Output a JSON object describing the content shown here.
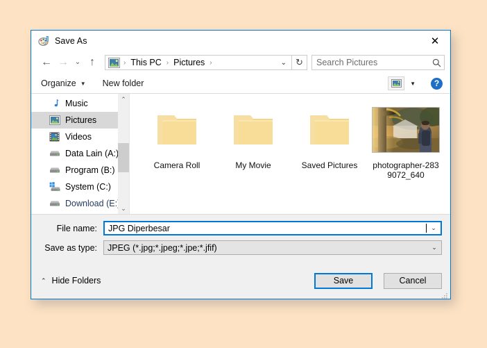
{
  "window": {
    "title": "Save As",
    "title_icon": "paint-palette-icon",
    "close_label": "✕"
  },
  "nav": {
    "back_icon": "←",
    "forward_icon": "→",
    "recent_icon": "⌄",
    "up_icon": "↑",
    "refresh_icon": "↻",
    "breadcrumb": [
      "This PC",
      "Pictures"
    ],
    "breadcrumb_sep": "›",
    "breadcrumb_chevron": "⌄"
  },
  "search": {
    "placeholder": "Search Pictures",
    "icon": "search-icon"
  },
  "toolbar": {
    "organize_label": "Organize",
    "organize_caret": "▼",
    "new_folder_label": "New folder",
    "view_caret": "▼",
    "help_label": "?"
  },
  "sidebar": {
    "items": [
      {
        "label": "Music",
        "icon": "music-note-icon",
        "selected": false
      },
      {
        "label": "Pictures",
        "icon": "pictures-icon",
        "selected": true
      },
      {
        "label": "Videos",
        "icon": "videos-film-icon",
        "selected": false
      },
      {
        "label": "Data Lain (A:)",
        "icon": "drive-icon",
        "selected": false
      },
      {
        "label": "Program (B:)",
        "icon": "drive-icon",
        "selected": false
      },
      {
        "label": "System (C:)",
        "icon": "windows-drive-icon",
        "selected": false
      },
      {
        "label": "Download (E:)",
        "icon": "drive-icon",
        "selected": false
      }
    ],
    "scroll_up_icon": "⌃",
    "scroll_down_icon": "⌄"
  },
  "files": [
    {
      "name": "Camera Roll",
      "type": "folder"
    },
    {
      "name": "My Movie",
      "type": "folder"
    },
    {
      "name": "Saved Pictures",
      "type": "folder"
    },
    {
      "name": "photographer-2839072_640",
      "type": "image"
    }
  ],
  "form": {
    "file_name_label": "File name:",
    "file_name_value": "JPG Diperbesar",
    "save_as_type_label": "Save as type:",
    "save_as_type_value": "JPEG (*.jpg;*.jpeg;*.jpe;*.jfif)",
    "combo_caret": "⌄"
  },
  "footer": {
    "hide_folders_label": "Hide Folders",
    "hide_folders_caret": "⌃",
    "save_label": "Save",
    "cancel_label": "Cancel"
  },
  "colors": {
    "page_background": "#fde3c3",
    "accent": "#0078d7",
    "folder": "#f7d98a",
    "selection": "#d8d8d8"
  }
}
